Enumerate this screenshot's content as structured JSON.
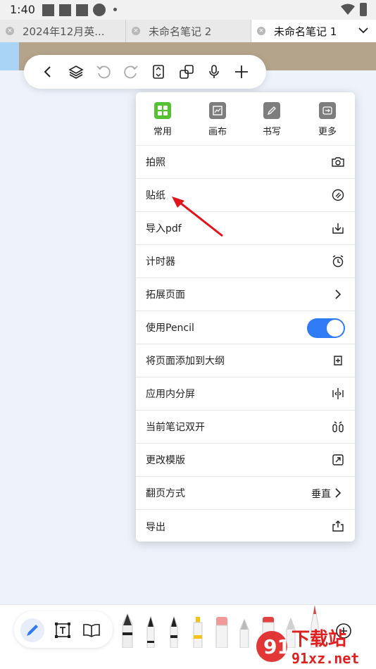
{
  "status_bar": {
    "time": "1:40"
  },
  "tabs": [
    {
      "label": "2024年12月英...",
      "active": false
    },
    {
      "label": "未命名笔记 2",
      "active": false
    },
    {
      "label": "未命名笔记 1",
      "active": true
    }
  ],
  "toolbar": {
    "buttons": [
      "back-icon",
      "layers-icon",
      "undo-icon",
      "redo-icon",
      "page-icon",
      "copy-icon",
      "microphone-icon",
      "add-icon"
    ]
  },
  "menu": {
    "categories": [
      {
        "label": "常用",
        "icon": "grid-icon",
        "color": "#55c234"
      },
      {
        "label": "画布",
        "icon": "canvas-icon",
        "color": "#7d7d7d"
      },
      {
        "label": "书写",
        "icon": "write-icon",
        "color": "#7d7d7d"
      },
      {
        "label": "更多",
        "icon": "more-icon",
        "color": "#7d7d7d"
      }
    ],
    "items": [
      {
        "label": "拍照",
        "icon": "camera-icon"
      },
      {
        "label": "贴纸",
        "icon": "sticker-icon"
      },
      {
        "label": "导入pdf",
        "icon": "import-icon"
      },
      {
        "label": "计时器",
        "icon": "alarm-icon"
      },
      {
        "label": "拓展页面",
        "icon": "chevron-right-icon"
      },
      {
        "label": "使用Pencil",
        "toggle": true
      },
      {
        "label": "将页面添加到大纲",
        "icon": "outline-icon"
      },
      {
        "label": "应用内分屏",
        "icon": "split-icon"
      },
      {
        "label": "当前笔记双开",
        "icon": "dual-open-icon"
      },
      {
        "label": "更改模版",
        "icon": "template-icon"
      },
      {
        "label": "翻页方式",
        "value": "垂直",
        "icon": "chevron-right-icon"
      },
      {
        "label": "导出",
        "icon": "share-icon"
      }
    ]
  },
  "bottom": {
    "tools": [
      "pen-tool-icon",
      "text-box-icon",
      "book-icon"
    ],
    "pens": [
      "fountain-pen",
      "ballpoint-pen",
      "marker-pen",
      "highlighter-yellow",
      "eraser-pink",
      "pencil-gray",
      "brush-red",
      "pencil-light",
      "pen-red-tip",
      "add-pen"
    ]
  },
  "colors": {
    "accent": "#2f7bf5",
    "canvas": "#eef2fb",
    "green": "#55c234"
  },
  "watermark": {
    "brand": "91",
    "text": "下载站",
    "url": "91xz.net"
  }
}
